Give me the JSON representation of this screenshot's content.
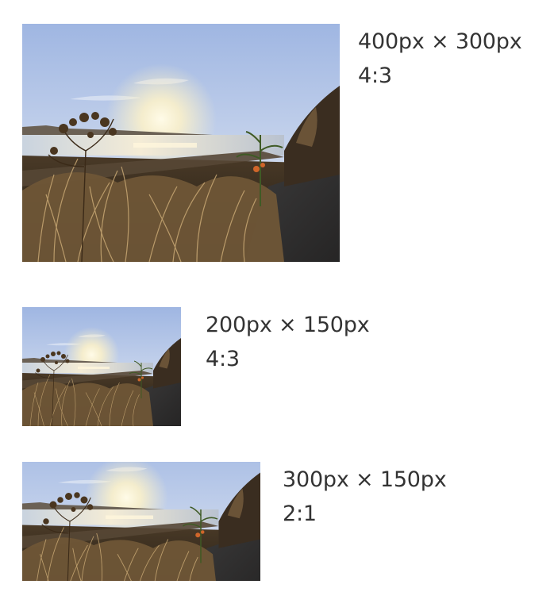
{
  "figures": [
    {
      "dimensions": "400px × 300px",
      "ratio": "4:3",
      "image": "sunset-grass-photo"
    },
    {
      "dimensions": "200px × 150px",
      "ratio": "4:3",
      "image": "sunset-grass-photo"
    },
    {
      "dimensions": "300px × 150px",
      "ratio": "2:1",
      "image": "sunset-grass-photo"
    }
  ]
}
